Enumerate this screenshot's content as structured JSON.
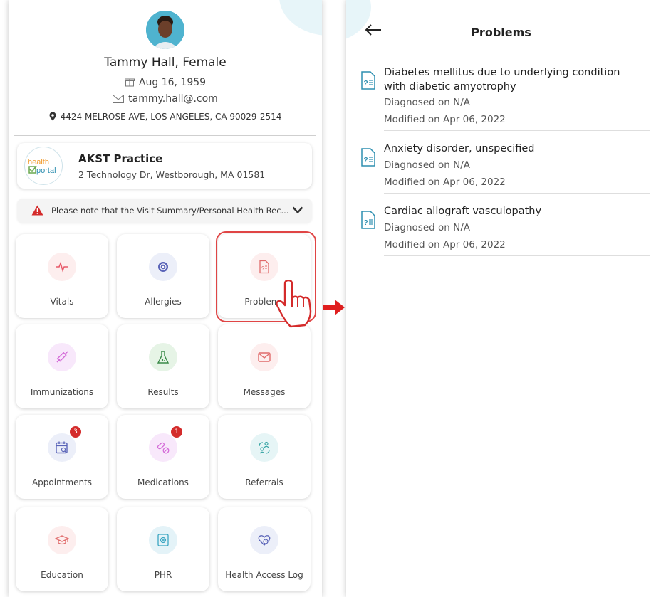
{
  "patient": {
    "name": "Tammy Hall, Female",
    "dob": "Aug 16, 1959",
    "email": "tammy.hall@.com",
    "address": "4424 MELROSE AVE, LOS ANGELES, CA 90029-2514"
  },
  "practice": {
    "logo_text_1": "health",
    "logo_text_2": "portal",
    "name": "AKST Practice",
    "address": "2 Technology Dr, Westborough, MA 01581"
  },
  "notice": {
    "text": "Please note that the Visit Summary/Personal Health Rec..."
  },
  "tiles": [
    {
      "label": "Vitals",
      "icon": "vitals-icon",
      "color": "#e85a6a",
      "bg": "#fdeeee"
    },
    {
      "label": "Allergies",
      "icon": "allergies-icon",
      "color": "#5a64b8",
      "bg": "#eceff9"
    },
    {
      "label": "Problems",
      "icon": "problems-icon",
      "color": "#e06a6a",
      "bg": "#fdeeee"
    },
    {
      "label": "Immunizations",
      "icon": "syringe-icon",
      "color": "#d46ad8",
      "bg": "#f8e8fb"
    },
    {
      "label": "Results",
      "icon": "flask-icon",
      "color": "#3a8a48",
      "bg": "#e6f4e6"
    },
    {
      "label": "Messages",
      "icon": "mail-icon",
      "color": "#e06a6a",
      "bg": "#fdeeee"
    },
    {
      "label": "Appointments",
      "icon": "calendar-icon",
      "color": "#5a64b8",
      "bg": "#eceff9",
      "badge": "3"
    },
    {
      "label": "Medications",
      "icon": "pills-icon",
      "color": "#d46ad8",
      "bg": "#f8e8fb",
      "badge": "1"
    },
    {
      "label": "Referrals",
      "icon": "referrals-icon",
      "color": "#3aa6a6",
      "bg": "#e6f5f6"
    },
    {
      "label": "Education",
      "icon": "education-icon",
      "color": "#e06a6a",
      "bg": "#fdeeee"
    },
    {
      "label": "PHR",
      "icon": "phr-icon",
      "color": "#3aa6c2",
      "bg": "#e4f3f8"
    },
    {
      "label": "Health Access Log",
      "icon": "access-log-icon",
      "color": "#5a64b8",
      "bg": "#eceff9"
    }
  ],
  "problems_screen": {
    "title": "Problems",
    "items": [
      {
        "title": "Diabetes mellitus due to underlying condition with diabetic amyotrophy",
        "diagnosed": "Diagnosed on N/A",
        "modified": "Modified on Apr 06, 2022"
      },
      {
        "title": "Anxiety disorder, unspecified",
        "diagnosed": "Diagnosed on N/A",
        "modified": "Modified on Apr 06, 2022"
      },
      {
        "title": "Cardiac allograft vasculopathy",
        "diagnosed": "Diagnosed on N/A",
        "modified": "Modified on Apr 06, 2022"
      }
    ]
  },
  "colors": {
    "accent_red": "#e04545",
    "doc_icon": "#2e8fb0"
  }
}
